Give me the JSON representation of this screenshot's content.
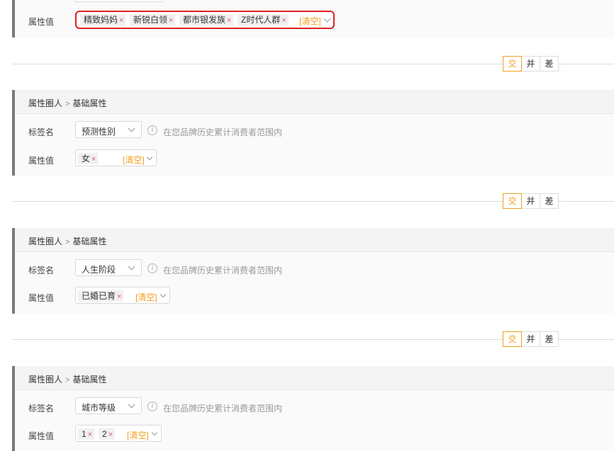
{
  "operators": {
    "intersect": "交",
    "union": "并",
    "difference": "差"
  },
  "common": {
    "tag_name_label": "标签名",
    "attr_value_label": "属性值",
    "clear_label": "[清空]",
    "hint_text": "在您品牌历史累计消费者范围内",
    "tag_remove": "×",
    "crumb_root": "属性圈人",
    "crumb_sep": ">",
    "crumb_leaf": "基础属性"
  },
  "blocks": [
    {
      "tags": [
        "精致妈妈",
        "新锐白领",
        "都市银发族",
        "Z时代人群"
      ],
      "highlighted": true
    },
    {
      "tag_name": "预测性别",
      "tags": [
        "女"
      ]
    },
    {
      "tag_name": "人生阶段",
      "tags": [
        "已婚已育"
      ]
    },
    {
      "tag_name": "城市等级",
      "tags": [
        "1",
        "2"
      ]
    }
  ],
  "colors": {
    "accent": "#f0a020",
    "remove": "#e05a5a",
    "highlight_border": "#e02020",
    "panel_rule": "#7a7a7a"
  }
}
